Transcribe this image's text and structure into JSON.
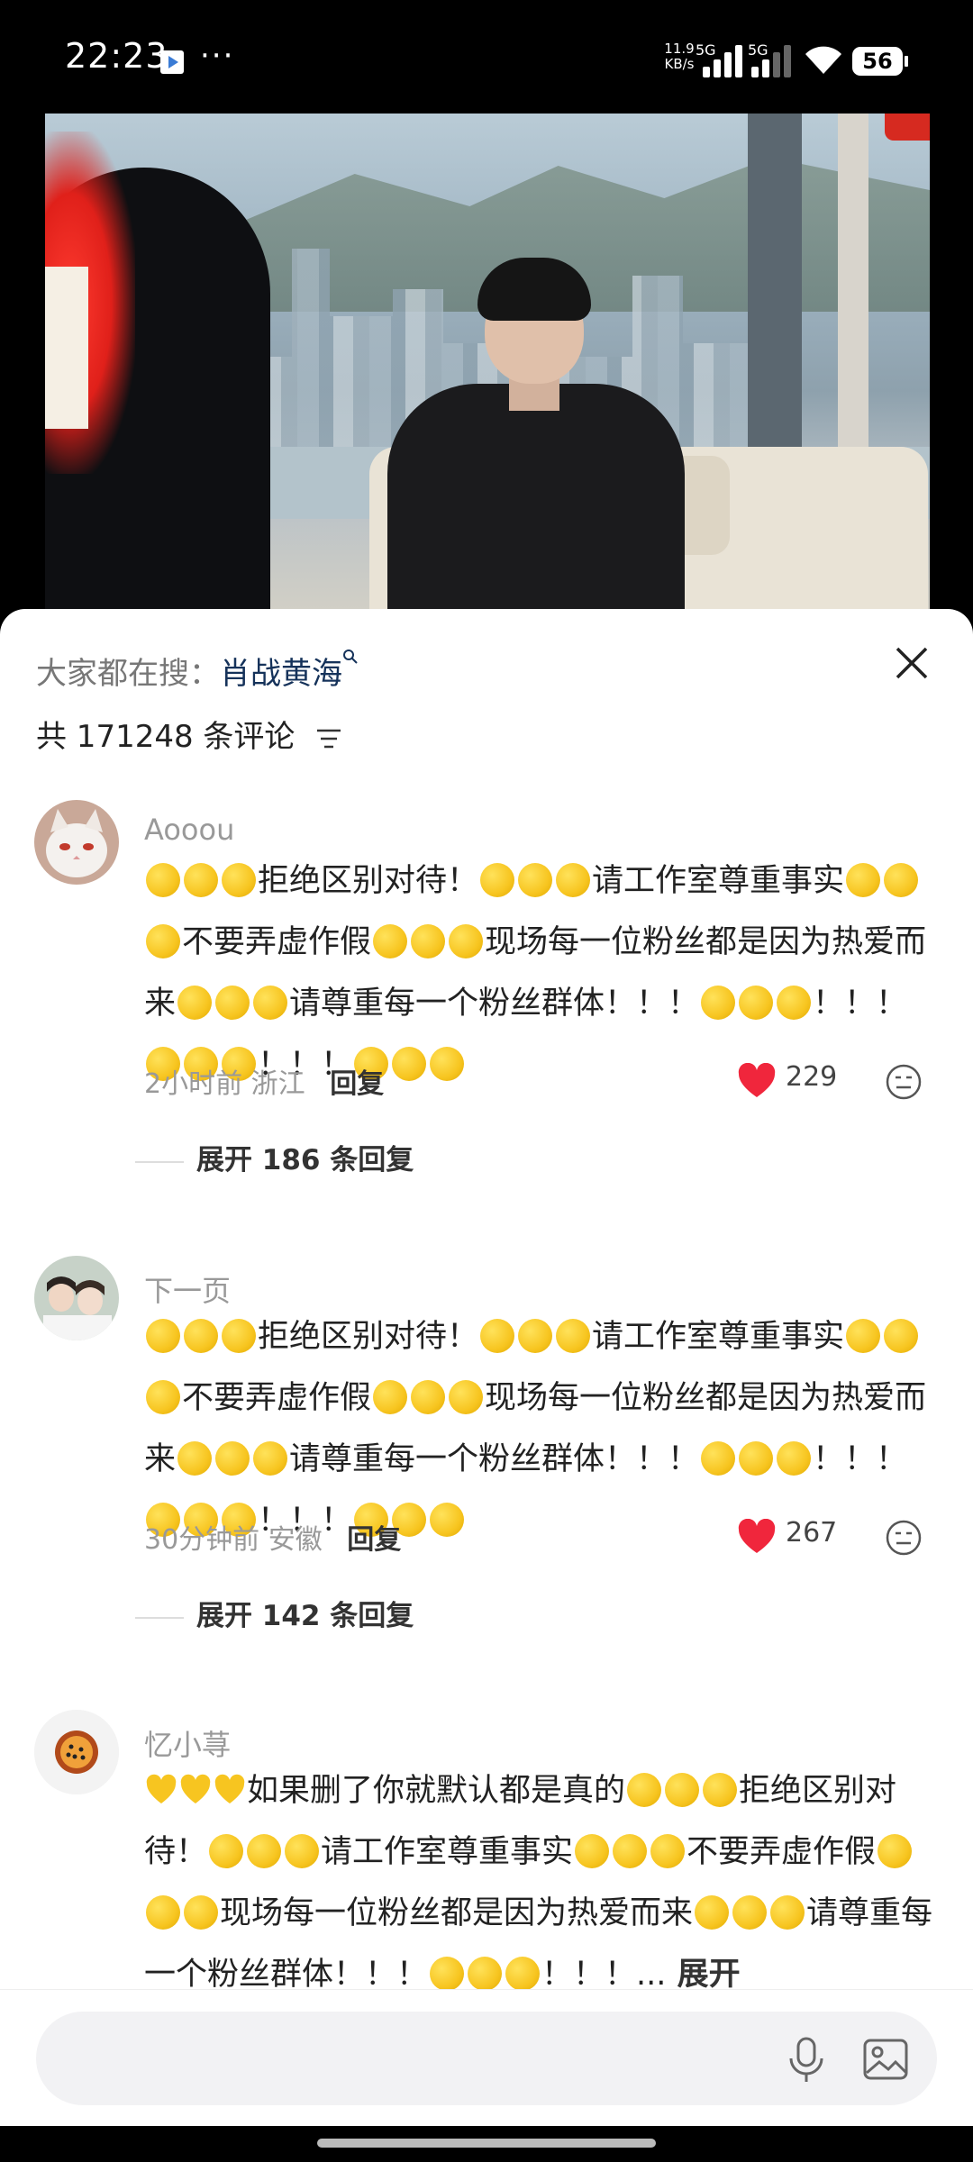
{
  "status_bar": {
    "time": "22:23",
    "network_speed": "11.9 KB/s",
    "sim1_type": "5G",
    "sim2_type": "5G",
    "battery": "56"
  },
  "sheet": {
    "search_prefix": "大家都在搜：",
    "search_term": "肖战黄海",
    "comment_count_label": "共 171248 条评论"
  },
  "comments": [
    {
      "username": "Aooou",
      "segments": [
        "🟡🟡🟡",
        "拒绝区别对待！",
        "🟡🟡🟡",
        "请工作室尊重事实",
        "🟡🟡🟡",
        "不要弄虚作假",
        "🟡🟡🟡",
        "现场每一位粉丝都是因为热爱而来",
        "🟡🟡🟡",
        "请尊重每一个粉丝群体！！！",
        "🟡🟡🟡",
        "！！！",
        "🟡🟡🟡",
        "！！！",
        "🟡🟡🟡"
      ],
      "time": "2小时前",
      "location": "浙江",
      "reply_label": "回复",
      "likes": "229",
      "expand_label": "展开 186 条回复"
    },
    {
      "username": "下一页",
      "segments": [
        "🟡🟡🟡",
        "拒绝区别对待！",
        "🟡🟡🟡",
        "请工作室尊重事实",
        "🟡🟡🟡",
        "不要弄虚作假",
        "🟡🟡🟡",
        "现场每一位粉丝都是因为热爱而来",
        "🟡🟡🟡",
        "请尊重每一个粉丝群体！！！",
        "🟡🟡🟡",
        "！！！",
        "🟡🟡🟡",
        "！！！",
        "🟡🟡🟡"
      ],
      "time": "30分钟前",
      "location": "安徽",
      "reply_label": "回复",
      "likes": "267",
      "expand_label": "展开 142 条回复"
    },
    {
      "username": "忆小荨",
      "segments": [
        "💛💛💛",
        "如果删了你就默认都是真的",
        "🟡🟡🟡",
        "拒绝区别对待！",
        "🟡🟡🟡",
        "请工作室尊重事实",
        "🟡🟡🟡",
        "不要弄虚作假",
        "🟡🟡🟡",
        "现场每一位粉丝都是因为热爱而来",
        "🟡🟡🟡",
        "请尊重每一个粉丝群体！！！",
        "🟡🟡🟡",
        "！！！..."
      ],
      "more_label": "展开"
    }
  ],
  "colors": {
    "accent_search_term": "#15325a",
    "like_heart": "#f0263c",
    "coin": "#f7c520"
  }
}
